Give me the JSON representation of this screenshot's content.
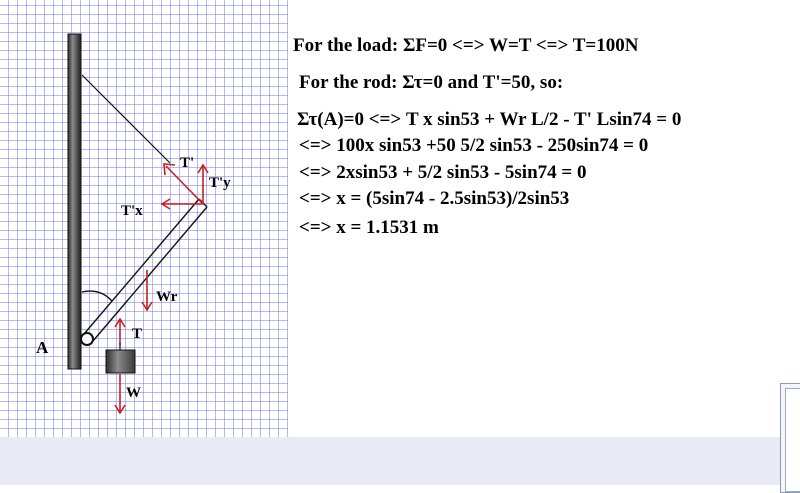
{
  "diagram": {
    "labels": {
      "t_prime": "T'",
      "t_prime_y": "T'y",
      "t_prime_x": "T'x",
      "wr": "Wr",
      "t": "T",
      "w": "W",
      "a": "A"
    },
    "colors": {
      "grid": "#7882f0",
      "pole": "#555555",
      "force_arrows": "#cc1e1e",
      "background": "#ffffff"
    }
  },
  "equations": {
    "load_line": "For the load: ΣF=0 <=> W=T <=> T=100N",
    "rod_line": "For the rod: Στ=0 and T'=50, so:",
    "torque_line": "Στ(A)=0 <=> T x sin53 + Wr L/2 - T' Lsin74 = 0",
    "step1": "<=> 100x sin53 +50 5/2 sin53 - 250sin74 = 0",
    "step2": "<=> 2xsin53 + 5/2 sin53 - 5sin74 = 0",
    "step3": "<=> x = (5sin74 - 2.5sin53)/2sin53",
    "step4": "<=> x = 1.1531 m"
  }
}
